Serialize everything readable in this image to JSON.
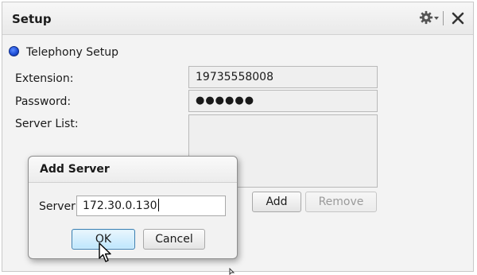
{
  "window": {
    "title": "Setup",
    "gear_icon": "gear-icon",
    "close_icon": "close-icon"
  },
  "section": {
    "label": "Telephony Setup",
    "radio_color": "#1f4fd8"
  },
  "fields": {
    "extension_label": "Extension:",
    "extension_value": "19735558008",
    "password_label": "Password:",
    "password_value": "●●●●●●",
    "server_list_label": "Server List:"
  },
  "buttons": {
    "add": "Add",
    "remove": "Remove"
  },
  "dialog": {
    "title": "Add Server",
    "server_label": "Server",
    "server_value": "172.30.0.130",
    "ok": "OK",
    "cancel": "Cancel"
  },
  "colors": {
    "ok_button_border": "#3c7fb1",
    "ok_button_fill": "#bee6fd"
  }
}
